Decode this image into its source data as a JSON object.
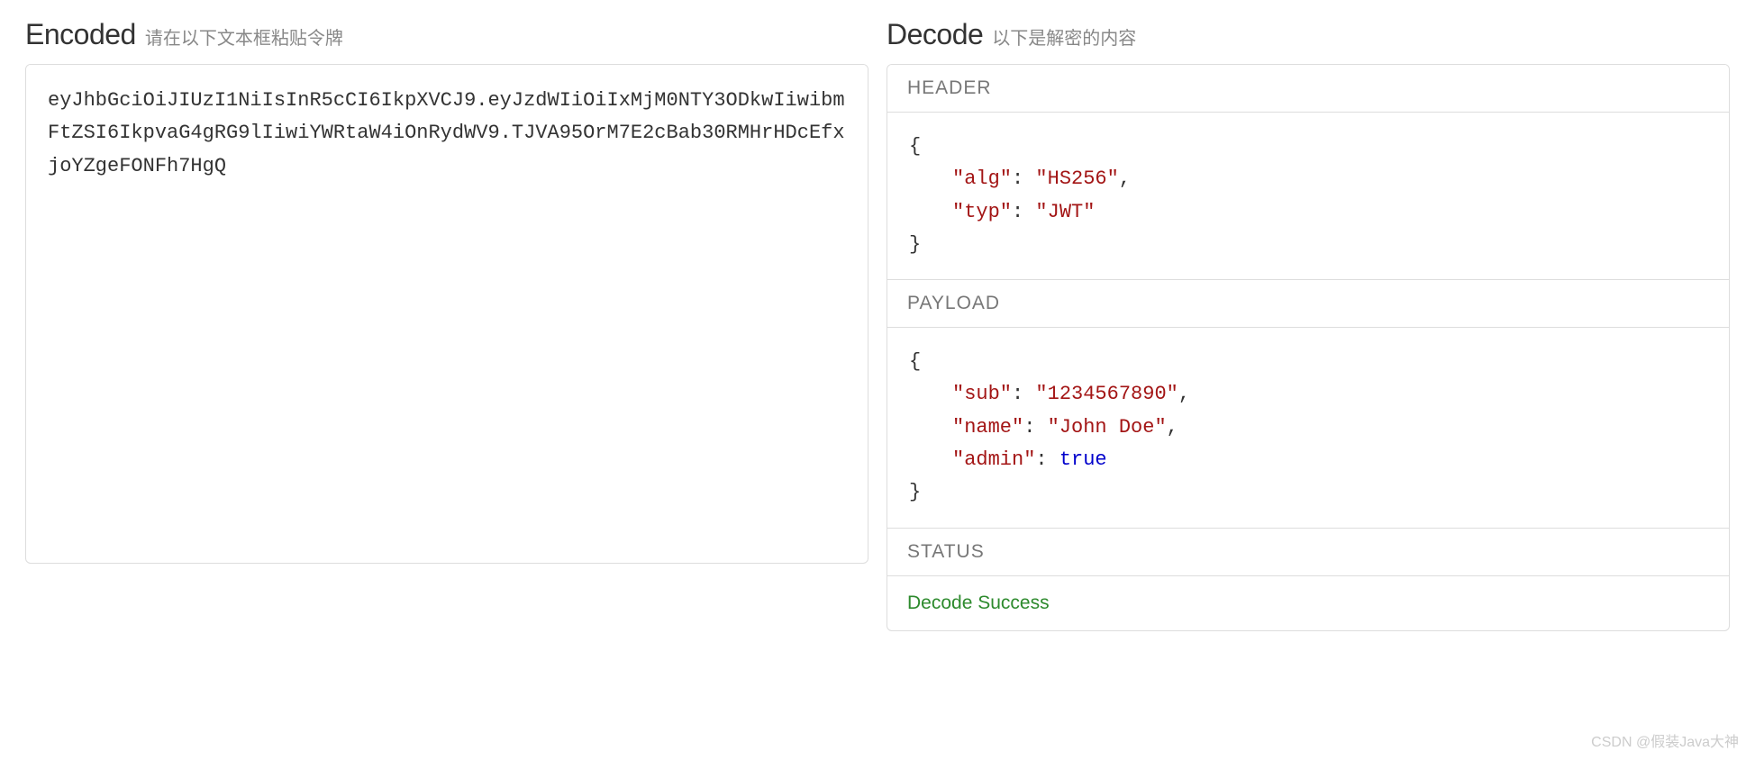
{
  "encoded": {
    "title": "Encoded",
    "subtitle": "请在以下文本框粘贴令牌",
    "token": "eyJhbGciOiJIUzI1NiIsInR5cCI6IkpXVCJ9.eyJzdWIiOiIxMjM0NTY3ODkwIiwibmFtZSI6IkpvaG4gRG9lIiwiYWRtaW4iOnRydWV9.TJVA95OrM7E2cBab30RMHrHDcEfxjoYZgeFONFh7HgQ"
  },
  "decode": {
    "title": "Decode",
    "subtitle": "以下是解密的内容",
    "header_label": "HEADER",
    "payload_label": "PAYLOAD",
    "status_label": "STATUS",
    "header_json": {
      "alg_key": "\"alg\"",
      "alg_val": "\"HS256\"",
      "typ_key": "\"typ\"",
      "typ_val": "\"JWT\""
    },
    "payload_json": {
      "sub_key": "\"sub\"",
      "sub_val": "\"1234567890\"",
      "name_key": "\"name\"",
      "name_val": "\"John Doe\"",
      "admin_key": "\"admin\"",
      "admin_val": "true"
    },
    "status_text": "Decode Success"
  },
  "watermark": "CSDN @假装Java大神",
  "punct": {
    "colon": ": ",
    "comma": ",",
    "brace_open": "{",
    "brace_close": "}"
  }
}
